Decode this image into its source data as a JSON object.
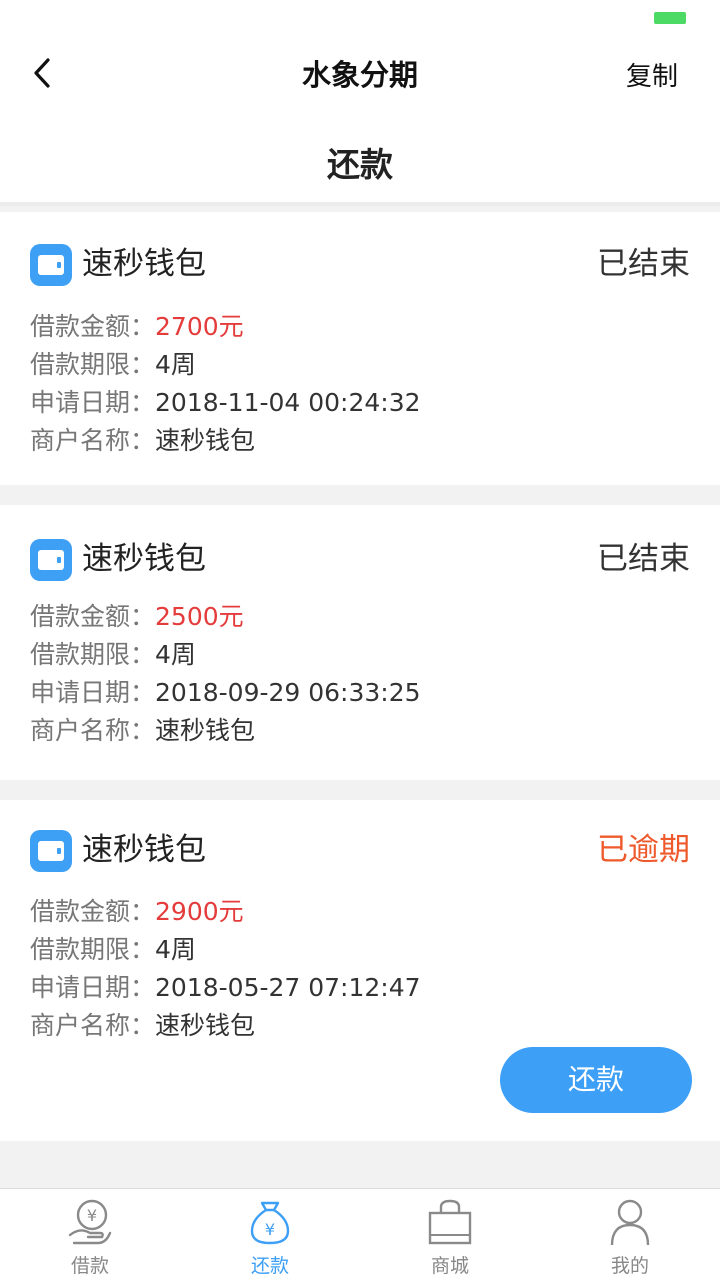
{
  "nav": {
    "title": "水象分期",
    "right_action": "复制"
  },
  "page": {
    "title": "还款"
  },
  "labels": {
    "amount": "借款金额：",
    "term": "借款期限：",
    "date": "申请日期：",
    "merchant": "商户名称："
  },
  "loans": [
    {
      "name": "速秒钱包",
      "status": "已结束",
      "amount": "2700元",
      "term": "4周",
      "date": "2018-11-04 00:24:32",
      "merchant": "速秒钱包"
    },
    {
      "name": "速秒钱包",
      "status": "已结束",
      "amount": "2500元",
      "term": "4周",
      "date": "2018-09-29 06:33:25",
      "merchant": "速秒钱包"
    },
    {
      "name": "速秒钱包",
      "status": "已逾期",
      "amount": "2900元",
      "term": "4周",
      "date": "2018-05-27 07:12:47",
      "merchant": "速秒钱包",
      "action": "还款"
    }
  ],
  "tabs": [
    {
      "label": "借款",
      "icon": "loan-hand-icon",
      "active": false
    },
    {
      "label": "还款",
      "icon": "money-bag-icon",
      "active": true
    },
    {
      "label": "商城",
      "icon": "shopping-bag-icon",
      "active": false
    },
    {
      "label": "我的",
      "icon": "user-icon",
      "active": false
    }
  ],
  "colors": {
    "accent": "#3d9ff5",
    "amount_red": "#e43b3b",
    "overdue_orange": "#ef5a2d",
    "battery_green": "#4cd964"
  }
}
